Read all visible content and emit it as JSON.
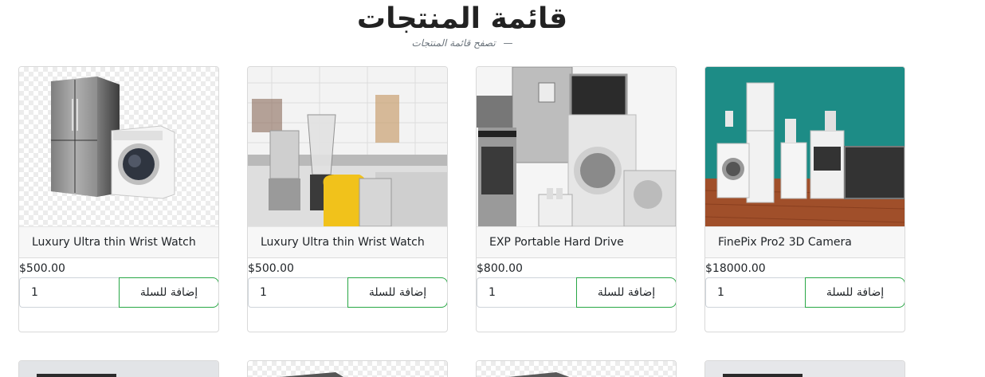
{
  "header": {
    "title": "قائمة المنتجات",
    "subtitle": "تصفح قائمة المنتجات",
    "subtitle_dash": "—"
  },
  "products": [
    {
      "title": "Luxury Ultra thin Wrist Watch",
      "price": "$500.00",
      "qty": "1",
      "add_label": "إضافة للسلة",
      "image": "fridge-and-washer-icon"
    },
    {
      "title": "Luxury Ultra thin Wrist Watch",
      "price": "$500.00",
      "qty": "1",
      "add_label": "إضافة للسلة",
      "image": "kitchen-appliances-icon"
    },
    {
      "title": "EXP Portable Hard Drive",
      "price": "$800.00",
      "qty": "1",
      "add_label": "إضافة للسلة",
      "image": "home-appliances-icon"
    },
    {
      "title": "FinePix Pro2 3D Camera",
      "price": "$18000.00",
      "qty": "1",
      "add_label": "إضافة للسلة",
      "image": "appliances-room-icon"
    }
  ],
  "colors": {
    "accent_button_border": "#28a745"
  }
}
